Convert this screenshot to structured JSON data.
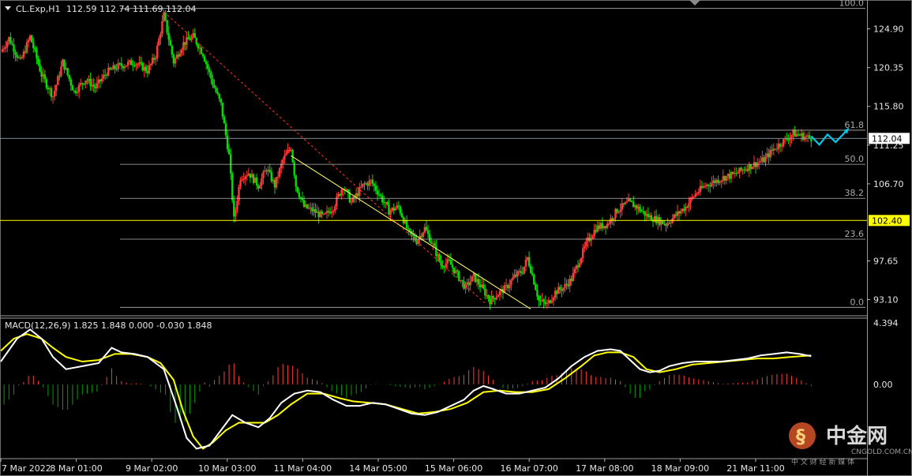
{
  "header": {
    "symbol_label": "CL.Exp,H1",
    "ohlc_label": "112.59 112.74 111.69 112.04"
  },
  "macd_header": {
    "label": "MACD(12,26,9) 1.825 1.848 0.000 -0.030 1.848"
  },
  "colors": {
    "background": "#000000",
    "bull": "#ff3b3b",
    "bear": "#00e000",
    "fib": "#c8c8c8",
    "macd_main": "#ffffff",
    "macd_signal": "#ffff00",
    "hist_pos": "#ff3b3b",
    "hist_neg": "#00a000",
    "channel_upper": "#ffff66",
    "channel_lower": "#ff3030",
    "arrows": "#00c8e8"
  },
  "chart_data": [
    {
      "type": "line",
      "symbol": "CL.Exp",
      "timeframe": "H1",
      "x_labels": [
        "7 Mar 2022",
        "8 Mar 01:00",
        "9 Mar 02:00",
        "10 Mar 03:00",
        "11 Mar 04:00",
        "14 Mar 05:00",
        "15 Mar 06:00",
        "16 Mar 07:00",
        "17 Mar 08:00",
        "18 Mar 09:00",
        "21 Mar 11:00"
      ],
      "y_ticks": [
        "124.90",
        "120.35",
        "115.80",
        "111.25",
        "106.70",
        "102.40",
        "97.65",
        "93.10"
      ],
      "ylim": [
        91.3,
        128.2
      ],
      "current_price": "112.04",
      "horizontal_level": "102.40",
      "price_path": [
        [
          0,
          122.2
        ],
        [
          5,
          123.8
        ],
        [
          12,
          121.0
        ],
        [
          18,
          124.0
        ],
        [
          25,
          119.5
        ],
        [
          32,
          117.0
        ],
        [
          38,
          121.0
        ],
        [
          45,
          117.5
        ],
        [
          52,
          119.0
        ],
        [
          58,
          118.0
        ],
        [
          65,
          119.8
        ],
        [
          72,
          120.5
        ],
        [
          82,
          121.0
        ],
        [
          90,
          120.0
        ],
        [
          95,
          121.8
        ],
        [
          100,
          126.5
        ],
        [
          106,
          121.0
        ],
        [
          112,
          123.2
        ],
        [
          118,
          124.0
        ],
        [
          124,
          122.0
        ],
        [
          130,
          118.5
        ],
        [
          135,
          116.0
        ],
        [
          140,
          110.0
        ],
        [
          143,
          102.5
        ],
        [
          147,
          107.5
        ],
        [
          152,
          108.0
        ],
        [
          158,
          106.5
        ],
        [
          163,
          108.5
        ],
        [
          168,
          106.5
        ],
        [
          173,
          109.5
        ],
        [
          178,
          111.0
        ],
        [
          181,
          106.5
        ],
        [
          186,
          104.0
        ],
        [
          192,
          103.5
        ],
        [
          198,
          102.8
        ],
        [
          204,
          104.0
        ],
        [
          210,
          106.5
        ],
        [
          215,
          104.5
        ],
        [
          222,
          106.5
        ],
        [
          227,
          107.0
        ],
        [
          232,
          105.5
        ],
        [
          238,
          103.5
        ],
        [
          244,
          104.0
        ],
        [
          250,
          101.0
        ],
        [
          255,
          100.0
        ],
        [
          260,
          101.5
        ],
        [
          265,
          99.5
        ],
        [
          270,
          97.2
        ],
        [
          275,
          97.5
        ],
        [
          280,
          96.0
        ],
        [
          285,
          94.5
        ],
        [
          290,
          95.8
        ],
        [
          295,
          94.5
        ],
        [
          300,
          93.0
        ],
        [
          305,
          93.8
        ],
        [
          310,
          94.5
        ],
        [
          315,
          95.8
        ],
        [
          320,
          96.5
        ],
        [
          323,
          98.0
        ],
        [
          326,
          96.0
        ],
        [
          330,
          93.0
        ],
        [
          335,
          92.5
        ],
        [
          340,
          94.0
        ],
        [
          345,
          94.5
        ],
        [
          350,
          95.5
        ],
        [
          355,
          97.8
        ],
        [
          360,
          100.0
        ],
        [
          365,
          101.5
        ],
        [
          372,
          102.0
        ],
        [
          378,
          103.6
        ],
        [
          385,
          104.5
        ],
        [
          390,
          104.0
        ],
        [
          396,
          103.0
        ],
        [
          402,
          102.5
        ],
        [
          408,
          102.0
        ],
        [
          414,
          103.0
        ],
        [
          420,
          104.0
        ],
        [
          426,
          105.5
        ],
        [
          432,
          106.5
        ],
        [
          438,
          107.0
        ],
        [
          444,
          107.5
        ],
        [
          450,
          107.8
        ],
        [
          456,
          108.5
        ],
        [
          462,
          109.0
        ],
        [
          468,
          109.5
        ],
        [
          474,
          110.8
        ],
        [
          480,
          111.7
        ],
        [
          486,
          112.6
        ],
        [
          492,
          112.3
        ],
        [
          497,
          112.04
        ]
      ],
      "fibonacci": {
        "levels": [
          {
            "label": "100.0",
            "price": 127.3
          },
          {
            "label": "61.8",
            "price": 113.0
          },
          {
            "label": "50.0",
            "price": 109.0
          },
          {
            "label": "38.2",
            "price": 105.0
          },
          {
            "label": "23.6",
            "price": 100.2
          },
          {
            "label": "0.0",
            "price": 92.2
          }
        ]
      },
      "descending_channel": {
        "upper": [
          [
            178,
            110.0
          ],
          [
            325,
            92.0
          ]
        ],
        "lower": [
          [
            100,
            126.9
          ],
          [
            298,
            92.5
          ]
        ]
      },
      "forecast_arrows": [
        [
          497,
          112.3
        ],
        [
          502,
          111.3
        ],
        [
          507,
          112.5
        ],
        [
          512,
          111.6
        ],
        [
          520,
          113.2
        ]
      ]
    },
    {
      "type": "bar",
      "name": "MACD(12,26,9)",
      "y_ticks": [
        "4.394",
        "0.00"
      ],
      "ylim": [
        -4.8,
        4.394
      ],
      "macd_main": [
        [
          0,
          1.5
        ],
        [
          10,
          3.0
        ],
        [
          18,
          3.6
        ],
        [
          25,
          3.0
        ],
        [
          32,
          1.8
        ],
        [
          40,
          1.0
        ],
        [
          50,
          1.2
        ],
        [
          60,
          1.4
        ],
        [
          68,
          2.4
        ],
        [
          74,
          2.1
        ],
        [
          82,
          2.0
        ],
        [
          90,
          1.8
        ],
        [
          100,
          1.0
        ],
        [
          108,
          -1.5
        ],
        [
          114,
          -3.5
        ],
        [
          120,
          -4.2
        ],
        [
          128,
          -4.0
        ],
        [
          135,
          -3.0
        ],
        [
          142,
          -2.0
        ],
        [
          150,
          -2.5
        ],
        [
          158,
          -2.8
        ],
        [
          165,
          -2.2
        ],
        [
          172,
          -1.2
        ],
        [
          180,
          -0.6
        ],
        [
          188,
          -0.4
        ],
        [
          196,
          -0.5
        ],
        [
          204,
          -1.0
        ],
        [
          212,
          -1.4
        ],
        [
          220,
          -1.4
        ],
        [
          228,
          -1.2
        ],
        [
          236,
          -1.3
        ],
        [
          244,
          -1.6
        ],
        [
          252,
          -1.9
        ],
        [
          260,
          -2.0
        ],
        [
          268,
          -1.8
        ],
        [
          276,
          -1.4
        ],
        [
          284,
          -1.0
        ],
        [
          290,
          -0.4
        ],
        [
          296,
          -0.1
        ],
        [
          302,
          -0.3
        ],
        [
          310,
          -0.6
        ],
        [
          318,
          -0.6
        ],
        [
          326,
          -0.4
        ],
        [
          334,
          -0.2
        ],
        [
          342,
          0.4
        ],
        [
          350,
          1.2
        ],
        [
          358,
          1.8
        ],
        [
          366,
          2.2
        ],
        [
          374,
          2.3
        ],
        [
          380,
          2.2
        ],
        [
          386,
          1.6
        ],
        [
          392,
          1.0
        ],
        [
          398,
          0.8
        ],
        [
          404,
          0.9
        ],
        [
          410,
          1.2
        ],
        [
          418,
          1.4
        ],
        [
          426,
          1.5
        ],
        [
          434,
          1.5
        ],
        [
          442,
          1.5
        ],
        [
          450,
          1.6
        ],
        [
          458,
          1.7
        ],
        [
          466,
          1.9
        ],
        [
          474,
          2.0
        ],
        [
          482,
          2.1
        ],
        [
          490,
          2.0
        ],
        [
          497,
          1.848
        ]
      ],
      "macd_signal": [
        [
          0,
          2.2
        ],
        [
          8,
          3.0
        ],
        [
          16,
          3.3
        ],
        [
          25,
          3.0
        ],
        [
          32,
          2.4
        ],
        [
          40,
          1.8
        ],
        [
          50,
          1.5
        ],
        [
          60,
          1.6
        ],
        [
          70,
          2.0
        ],
        [
          80,
          2.0
        ],
        [
          90,
          1.8
        ],
        [
          98,
          1.4
        ],
        [
          106,
          0.3
        ],
        [
          112,
          -1.8
        ],
        [
          118,
          -3.4
        ],
        [
          124,
          -4.2
        ],
        [
          130,
          -3.8
        ],
        [
          138,
          -3.0
        ],
        [
          146,
          -2.5
        ],
        [
          154,
          -2.5
        ],
        [
          162,
          -2.5
        ],
        [
          170,
          -2.0
        ],
        [
          178,
          -1.3
        ],
        [
          188,
          -0.6
        ],
        [
          198,
          -0.6
        ],
        [
          208,
          -0.9
        ],
        [
          216,
          -1.1
        ],
        [
          226,
          -1.2
        ],
        [
          236,
          -1.3
        ],
        [
          246,
          -1.6
        ],
        [
          256,
          -1.9
        ],
        [
          266,
          -1.8
        ],
        [
          276,
          -1.6
        ],
        [
          286,
          -1.2
        ],
        [
          296,
          -0.5
        ],
        [
          306,
          -0.4
        ],
        [
          316,
          -0.5
        ],
        [
          326,
          -0.5
        ],
        [
          336,
          -0.3
        ],
        [
          346,
          0.4
        ],
        [
          356,
          1.2
        ],
        [
          364,
          1.9
        ],
        [
          372,
          2.1
        ],
        [
          380,
          2.1
        ],
        [
          388,
          1.8
        ],
        [
          396,
          1.0
        ],
        [
          404,
          0.8
        ],
        [
          414,
          1.0
        ],
        [
          424,
          1.3
        ],
        [
          434,
          1.4
        ],
        [
          444,
          1.5
        ],
        [
          454,
          1.6
        ],
        [
          464,
          1.7
        ],
        [
          474,
          1.7
        ],
        [
          484,
          1.8
        ],
        [
          497,
          1.9
        ]
      ]
    }
  ],
  "watermark": {
    "brand": "中金网",
    "url": "CNGOLD.COM.CN",
    "tagline": "中 文 财 经 新 媒 体"
  }
}
